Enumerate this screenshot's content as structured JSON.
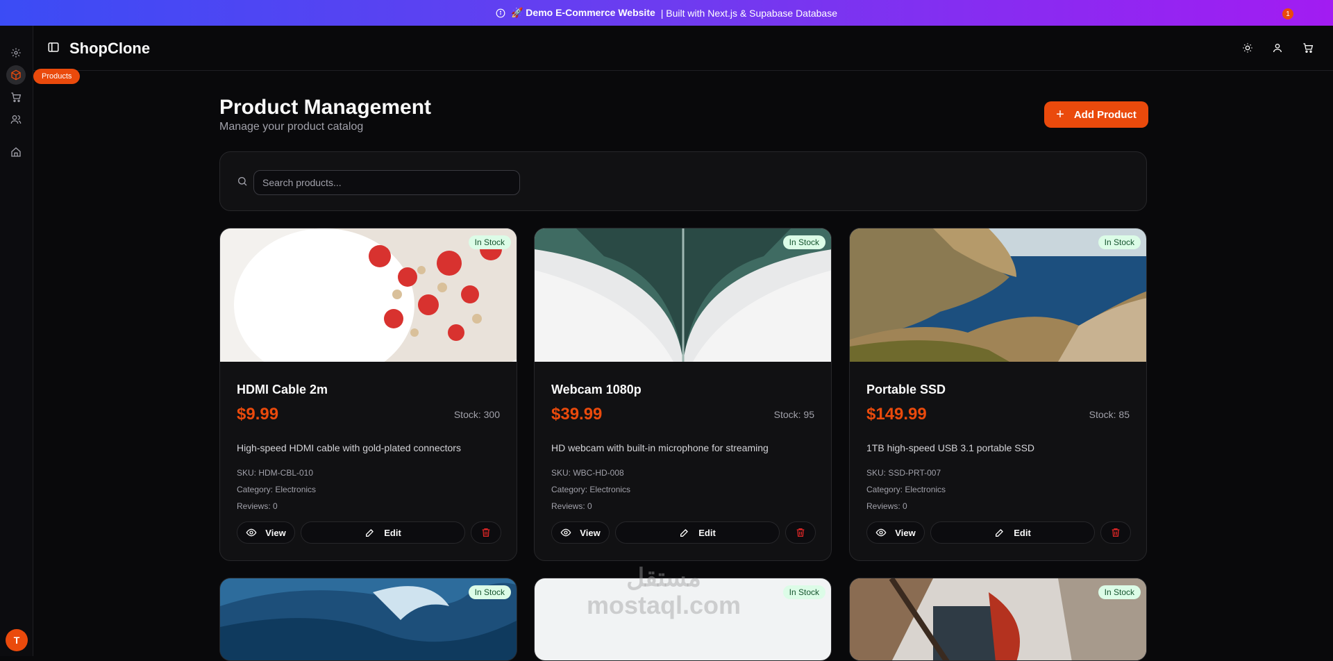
{
  "banner": {
    "title": "🚀 Demo E-Commerce Website",
    "subtitle": "| Built with Next.js & Supabase Database"
  },
  "rail": {
    "tooltip": "Products",
    "avatar_initial": "T"
  },
  "topbar": {
    "brand": "ShopClone",
    "cart_count": "1"
  },
  "page": {
    "title": "Product Management",
    "subtitle": "Manage your product catalog",
    "add_label": "Add Product"
  },
  "search": {
    "placeholder": "Search products..."
  },
  "labels": {
    "view": "View",
    "edit": "Edit"
  },
  "products": [
    {
      "name": "HDMI Cable 2m",
      "price": "$9.99",
      "stock": "Stock: 300",
      "desc": "High-speed HDMI cable with gold-plated connectors",
      "sku": "SKU: HDM-CBL-010",
      "category": "Category: Electronics",
      "reviews": "Reviews: 0",
      "badge": "In Stock"
    },
    {
      "name": "Webcam 1080p",
      "price": "$39.99",
      "stock": "Stock: 95",
      "desc": "HD webcam with built-in microphone for streaming",
      "sku": "SKU: WBC-HD-008",
      "category": "Category: Electronics",
      "reviews": "Reviews: 0",
      "badge": "In Stock"
    },
    {
      "name": "Portable SSD",
      "price": "$149.99",
      "stock": "Stock: 85",
      "desc": "1TB high-speed USB 3.1 portable SSD",
      "sku": "SKU: SSD-PRT-007",
      "category": "Category: Electronics",
      "reviews": "Reviews: 0",
      "badge": "In Stock"
    },
    {
      "badge": "In Stock"
    },
    {
      "badge": "In Stock"
    },
    {
      "badge": "In Stock"
    }
  ],
  "watermark": {
    "arabic": "مستقل",
    "latin": "mostaql.com"
  },
  "colors": {
    "accent": "#ea4a0c",
    "badge_bg": "#dcfce7",
    "banner_start": "#3b4cf5",
    "banner_end": "#a21cf2"
  }
}
